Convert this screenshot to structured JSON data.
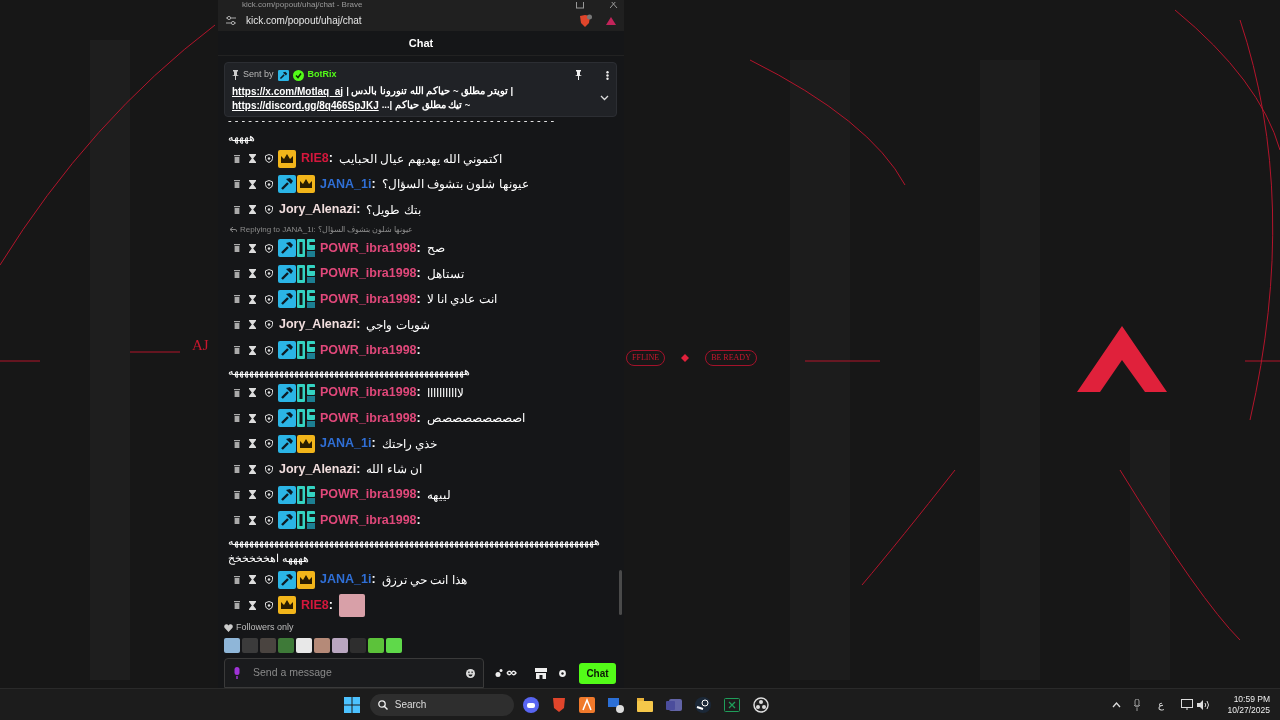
{
  "browser": {
    "title": "kick.com/popout/uhaj/chat - Brave",
    "address": "kick.com/popout/uhaj/chat"
  },
  "header": {
    "title": "Chat"
  },
  "pinned": {
    "sent_by": "Sent by",
    "author": "BotRix",
    "lines": [
      {
        "link": "https://x.com/Motlaq_aj",
        "text": "| تويتر مطلق ~ حياكم الله تنورونا بالدس |"
      },
      {
        "link": "https://discord.gg/8q466SpJKJ",
        "text": "~ تيك مطلق حياكم |..."
      }
    ]
  },
  "name_separator": ":",
  "messages": [
    {
      "kind": "overflow",
      "text": "- - - - - - - - - - - - - - - - - - - - - - - - - - - - - - - - - - - - - - - - - - - - - - - - -"
    },
    {
      "kind": "overflow",
      "text": "ههههه"
    },
    {
      "kind": "chat",
      "name": "RIE8",
      "color": "#d4173c",
      "badges": [
        {
          "kind": "crown"
        }
      ],
      "text": "اكتموني الله يهديهم عيال الحبايب"
    },
    {
      "kind": "chat",
      "name": "JANA_1i",
      "color": "#2f6fd6",
      "badges": [
        {
          "kind": "moderator"
        },
        {
          "kind": "crown"
        }
      ],
      "text": "عيونها شلون بتشوف السؤال؟"
    },
    {
      "kind": "chat",
      "name": "Jory_Alenazi",
      "color": "#f2dede",
      "text": "بتك طويل؟"
    },
    {
      "kind": "reply",
      "text": "Replying to JANA_1i: عيونها شلون بتشوف السؤال؟"
    },
    {
      "kind": "chat",
      "name": "POWR_ibra1998",
      "color": "#e0487a",
      "badges": [
        {
          "kind": "moderator"
        },
        {
          "kind": "og"
        }
      ],
      "text": "صح"
    },
    {
      "kind": "chat",
      "name": "POWR_ibra1998",
      "color": "#e0487a",
      "badges": [
        {
          "kind": "moderator"
        },
        {
          "kind": "og"
        }
      ],
      "text": "تستاهل"
    },
    {
      "kind": "chat",
      "name": "POWR_ibra1998",
      "color": "#e0487a",
      "badges": [
        {
          "kind": "moderator"
        },
        {
          "kind": "og"
        }
      ],
      "text": "انت عادي انا لا"
    },
    {
      "kind": "chat",
      "name": "Jory_Alenazi",
      "color": "#f2dede",
      "text": "شويات واجي"
    },
    {
      "kind": "chat",
      "name": "POWR_ibra1998",
      "color": "#e0487a",
      "badges": [
        {
          "kind": "moderator"
        },
        {
          "kind": "og"
        }
      ]
    },
    {
      "kind": "overflow",
      "text": "هههههههههههههههههههههههههههههههههههههههههههههههه"
    },
    {
      "kind": "chat",
      "name": "POWR_ibra1998",
      "color": "#e0487a",
      "badges": [
        {
          "kind": "moderator"
        },
        {
          "kind": "og"
        }
      ],
      "text": "لااااااااااا"
    },
    {
      "kind": "chat",
      "name": "POWR_ibra1998",
      "color": "#e0487a",
      "badges": [
        {
          "kind": "moderator"
        },
        {
          "kind": "og"
        }
      ],
      "text": "اصصصصصصصصص"
    },
    {
      "kind": "chat",
      "name": "JANA_1i",
      "color": "#2f6fd6",
      "badges": [
        {
          "kind": "moderator"
        },
        {
          "kind": "crown"
        }
      ],
      "text": "خذي راحتك"
    },
    {
      "kind": "chat",
      "name": "Jory_Alenazi",
      "color": "#f2dede",
      "text": "ان شاء الله"
    },
    {
      "kind": "chat",
      "name": "POWR_ibra1998",
      "color": "#e0487a",
      "badges": [
        {
          "kind": "moderator"
        },
        {
          "kind": "og"
        }
      ],
      "text": "لييهه"
    },
    {
      "kind": "chat",
      "name": "POWR_ibra1998",
      "color": "#e0487a",
      "badges": [
        {
          "kind": "moderator"
        },
        {
          "kind": "og"
        }
      ]
    },
    {
      "kind": "overflow",
      "text": "هههههههههههههههههههههههههههههههههههههههههههههههههههههههههههههههههههههههههه"
    },
    {
      "kind": "overflow",
      "text": "ههههه اهخخخخخخ"
    },
    {
      "kind": "chat",
      "name": "JANA_1i",
      "color": "#2f6fd6",
      "badges": [
        {
          "kind": "moderator"
        },
        {
          "kind": "crown"
        }
      ],
      "text": "هذا انت حي ترزق"
    },
    {
      "kind": "emote",
      "name": "RIE8",
      "color": "#d4173c",
      "badges": [
        {
          "kind": "crown"
        }
      ]
    }
  ],
  "chat_mode": "Followers only",
  "input": {
    "placeholder": "Send a message"
  },
  "send_button": "Chat",
  "wallpaper": {
    "monogram": "AJ",
    "status_tag": "FFLINE",
    "ready_tag": "BE READY"
  },
  "taskbar": {
    "search": "Search",
    "time": "10:59 PM",
    "date": "10/27/2025",
    "language": "ع"
  }
}
